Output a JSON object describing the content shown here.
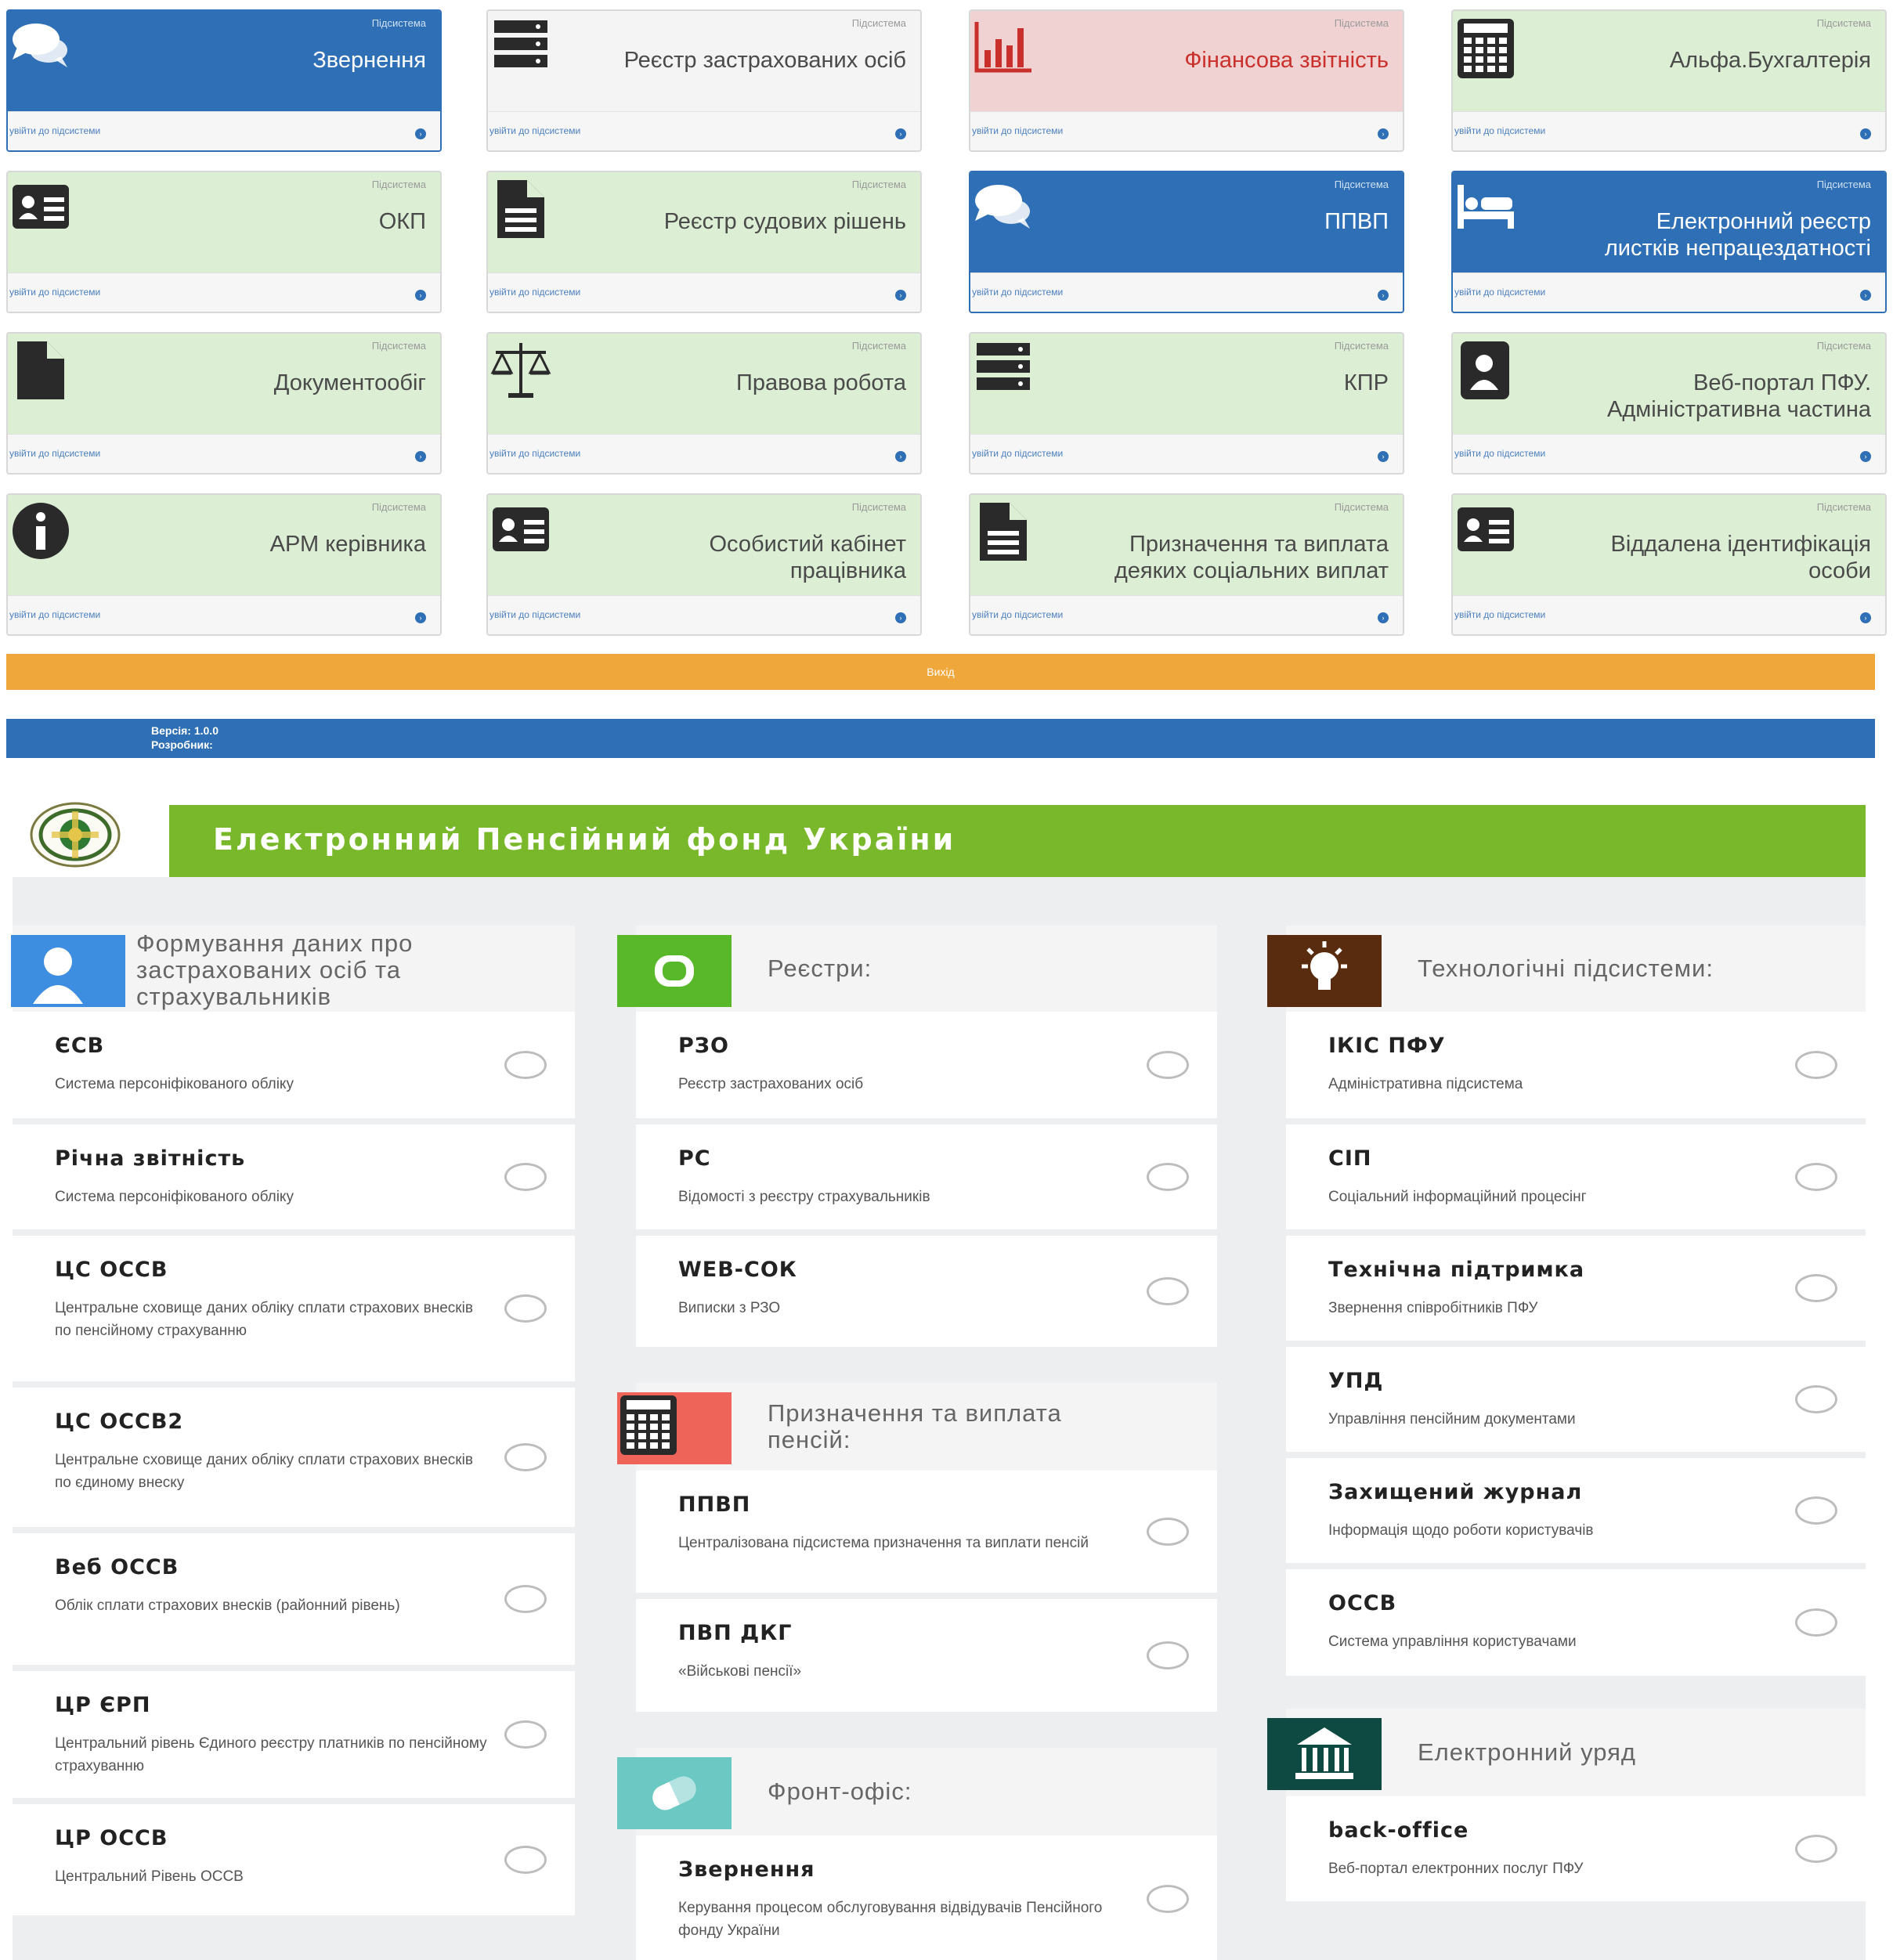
{
  "dashboard": {
    "tiles": [
      {
        "title": "Звернення",
        "subtitle": "Підсистема",
        "link": "увійти до підсистеми",
        "style": "blue",
        "icon": "chat-bubbles-icon"
      },
      {
        "title": "Реєстр застрахованих осіб",
        "subtitle": "Підсистема",
        "link": "увійти до підсистеми",
        "style": "gray",
        "icon": "server-icon"
      },
      {
        "title": "Фінансова звітність",
        "subtitle": "Підсистема",
        "link": "увійти до підсистеми",
        "style": "pink",
        "icon": "bar-chart-icon"
      },
      {
        "title": "Альфа.Бухгалтерія",
        "subtitle": "Підсистема",
        "link": "увійти до підсистеми",
        "style": "green",
        "icon": "calculator-icon"
      },
      {
        "title": "ОКП",
        "subtitle": "Підсистема",
        "link": "увійти до підсистеми",
        "style": "green",
        "icon": "id-card-icon"
      },
      {
        "title": "Реєстр судових рішень",
        "subtitle": "Підсистема",
        "link": "увійти до підсистеми",
        "style": "green",
        "icon": "document-icon"
      },
      {
        "title": "ППВП",
        "subtitle": "Підсистема",
        "link": "увійти до підсистеми",
        "style": "blue",
        "icon": "chat-bubbles-icon"
      },
      {
        "title": "Електронний реєстр\nлистків непрацездатності",
        "subtitle": "Підсистема",
        "link": "увійти до підсистеми",
        "style": "blue",
        "icon": "bed-icon"
      },
      {
        "title": "Документообіг",
        "subtitle": "Підсистема",
        "link": "увійти до підсистеми",
        "style": "green",
        "icon": "file-icon"
      },
      {
        "title": "Правова робота",
        "subtitle": "Підсистема",
        "link": "увійти до підсистеми",
        "style": "green",
        "icon": "scales-icon"
      },
      {
        "title": "КПР",
        "subtitle": "Підсистема",
        "link": "увійти до підсистеми",
        "style": "green",
        "icon": "server-icon"
      },
      {
        "title": "Веб-портал ПФУ.\nАдміністративна частина",
        "subtitle": "Підсистема",
        "link": "увійти до підсистеми",
        "style": "green",
        "icon": "address-book-icon"
      },
      {
        "title": "АРМ керівника",
        "subtitle": "Підсистема",
        "link": "увійти до підсистеми",
        "style": "green",
        "icon": "info-circle-icon"
      },
      {
        "title": "Особистий кабінет\nпрацівника",
        "subtitle": "Підсистема",
        "link": "увійти до підсистеми",
        "style": "green",
        "icon": "id-card-icon"
      },
      {
        "title": "Призначення та виплата\nдеяких соціальних виплат",
        "subtitle": "Підсистема",
        "link": "увійти до підсистеми",
        "style": "green",
        "icon": "document-icon"
      },
      {
        "title": "Віддалена ідентифікація\nособи",
        "subtitle": "Підсистема",
        "link": "увійти до підсистеми",
        "style": "green",
        "icon": "id-card-icon"
      }
    ],
    "exit_label": "Вихід",
    "version_line": "Версія: 1.0.0",
    "developer_line": "Розробник:"
  },
  "portal": {
    "title": "Електронний Пенсійний фонд України",
    "colors": {
      "green": "#79b82a",
      "blue": "#3d8de0",
      "lime": "#58b82a",
      "red": "#ee6459",
      "teal": "#6cc8c3",
      "brown": "#5a2c0f",
      "darkteal": "#0e4a42"
    },
    "sections": [
      {
        "title": "Формування даних про\nзастрахованих осіб та\nстрахувальників",
        "color": "#3d8de0",
        "icon": "person-icon",
        "items": [
          {
            "name": "ЄСВ",
            "desc": "Система персоніфікованого обліку"
          },
          {
            "name": "Річна звітність",
            "desc": "Система персоніфікованого обліку"
          },
          {
            "name": "ЦС ОССВ",
            "desc": "Центральне сховище даних обліку сплати страхових внесків по пенсійному страхуванню"
          },
          {
            "name": "ЦС ОССВ2",
            "desc": "Центральне сховище даних обліку сплати страхових внесків по єдиному внеску"
          },
          {
            "name": "Веб ОССВ",
            "desc": "Облік сплати страхових внесків (районний рівень)"
          },
          {
            "name": "ЦР ЄРП",
            "desc": "Центральний рівень Єдиного реєстру платників по пенсійному страхуванню"
          },
          {
            "name": "ЦР ОССВ",
            "desc": "Центральний Рівень ОССВ"
          }
        ]
      },
      {
        "title": "Реєстри:",
        "color": "#58b82a",
        "icon": "database-icon",
        "items": [
          {
            "name": "РЗО",
            "desc": "Реєстр застрахованих осіб"
          },
          {
            "name": "РС",
            "desc": "Відомості з реєстру страхувальників"
          },
          {
            "name": "WEB-СОК",
            "desc": "Виписки з РЗО"
          }
        ]
      },
      {
        "title": "Призначення та виплата\nпенсій:",
        "color": "#ee6459",
        "icon": "calculator-icon",
        "items": [
          {
            "name": "ППВП",
            "desc": "Централізована підсистема призначення та виплати пенсій"
          },
          {
            "name": "ПВП ДКГ",
            "desc": "«Військові пенсії»"
          }
        ]
      },
      {
        "title": "Фронт-офіс:",
        "color": "#6cc8c3",
        "icon": "pill-icon",
        "items": [
          {
            "name": "Звернення",
            "desc": "Керування процесом обслуговування відвідувачів Пенсійного фонду України"
          }
        ]
      },
      {
        "title": "Технологічні підсистеми:",
        "color": "#5a2c0f",
        "icon": "lightbulb-icon",
        "items": [
          {
            "name": "ІКІС ПФУ",
            "desc": "Адміністративна підсистема"
          },
          {
            "name": "СІП",
            "desc": "Соціальний інформаційний процесінг"
          },
          {
            "name": "Технічна підтримка",
            "desc": "Звернення співробітників ПФУ"
          },
          {
            "name": "УПД",
            "desc": "Управління пенсійним документами"
          },
          {
            "name": "Захищений журнал",
            "desc": "Інформація щодо роботи користувачів"
          },
          {
            "name": "ОССВ",
            "desc": "Система управління користувачами"
          }
        ]
      },
      {
        "title": "Електронний уряд",
        "color": "#0e4a42",
        "icon": "government-building-icon",
        "items": [
          {
            "name": "back-office",
            "desc": "Веб-портал електронних послуг ПФУ"
          }
        ]
      }
    ]
  }
}
